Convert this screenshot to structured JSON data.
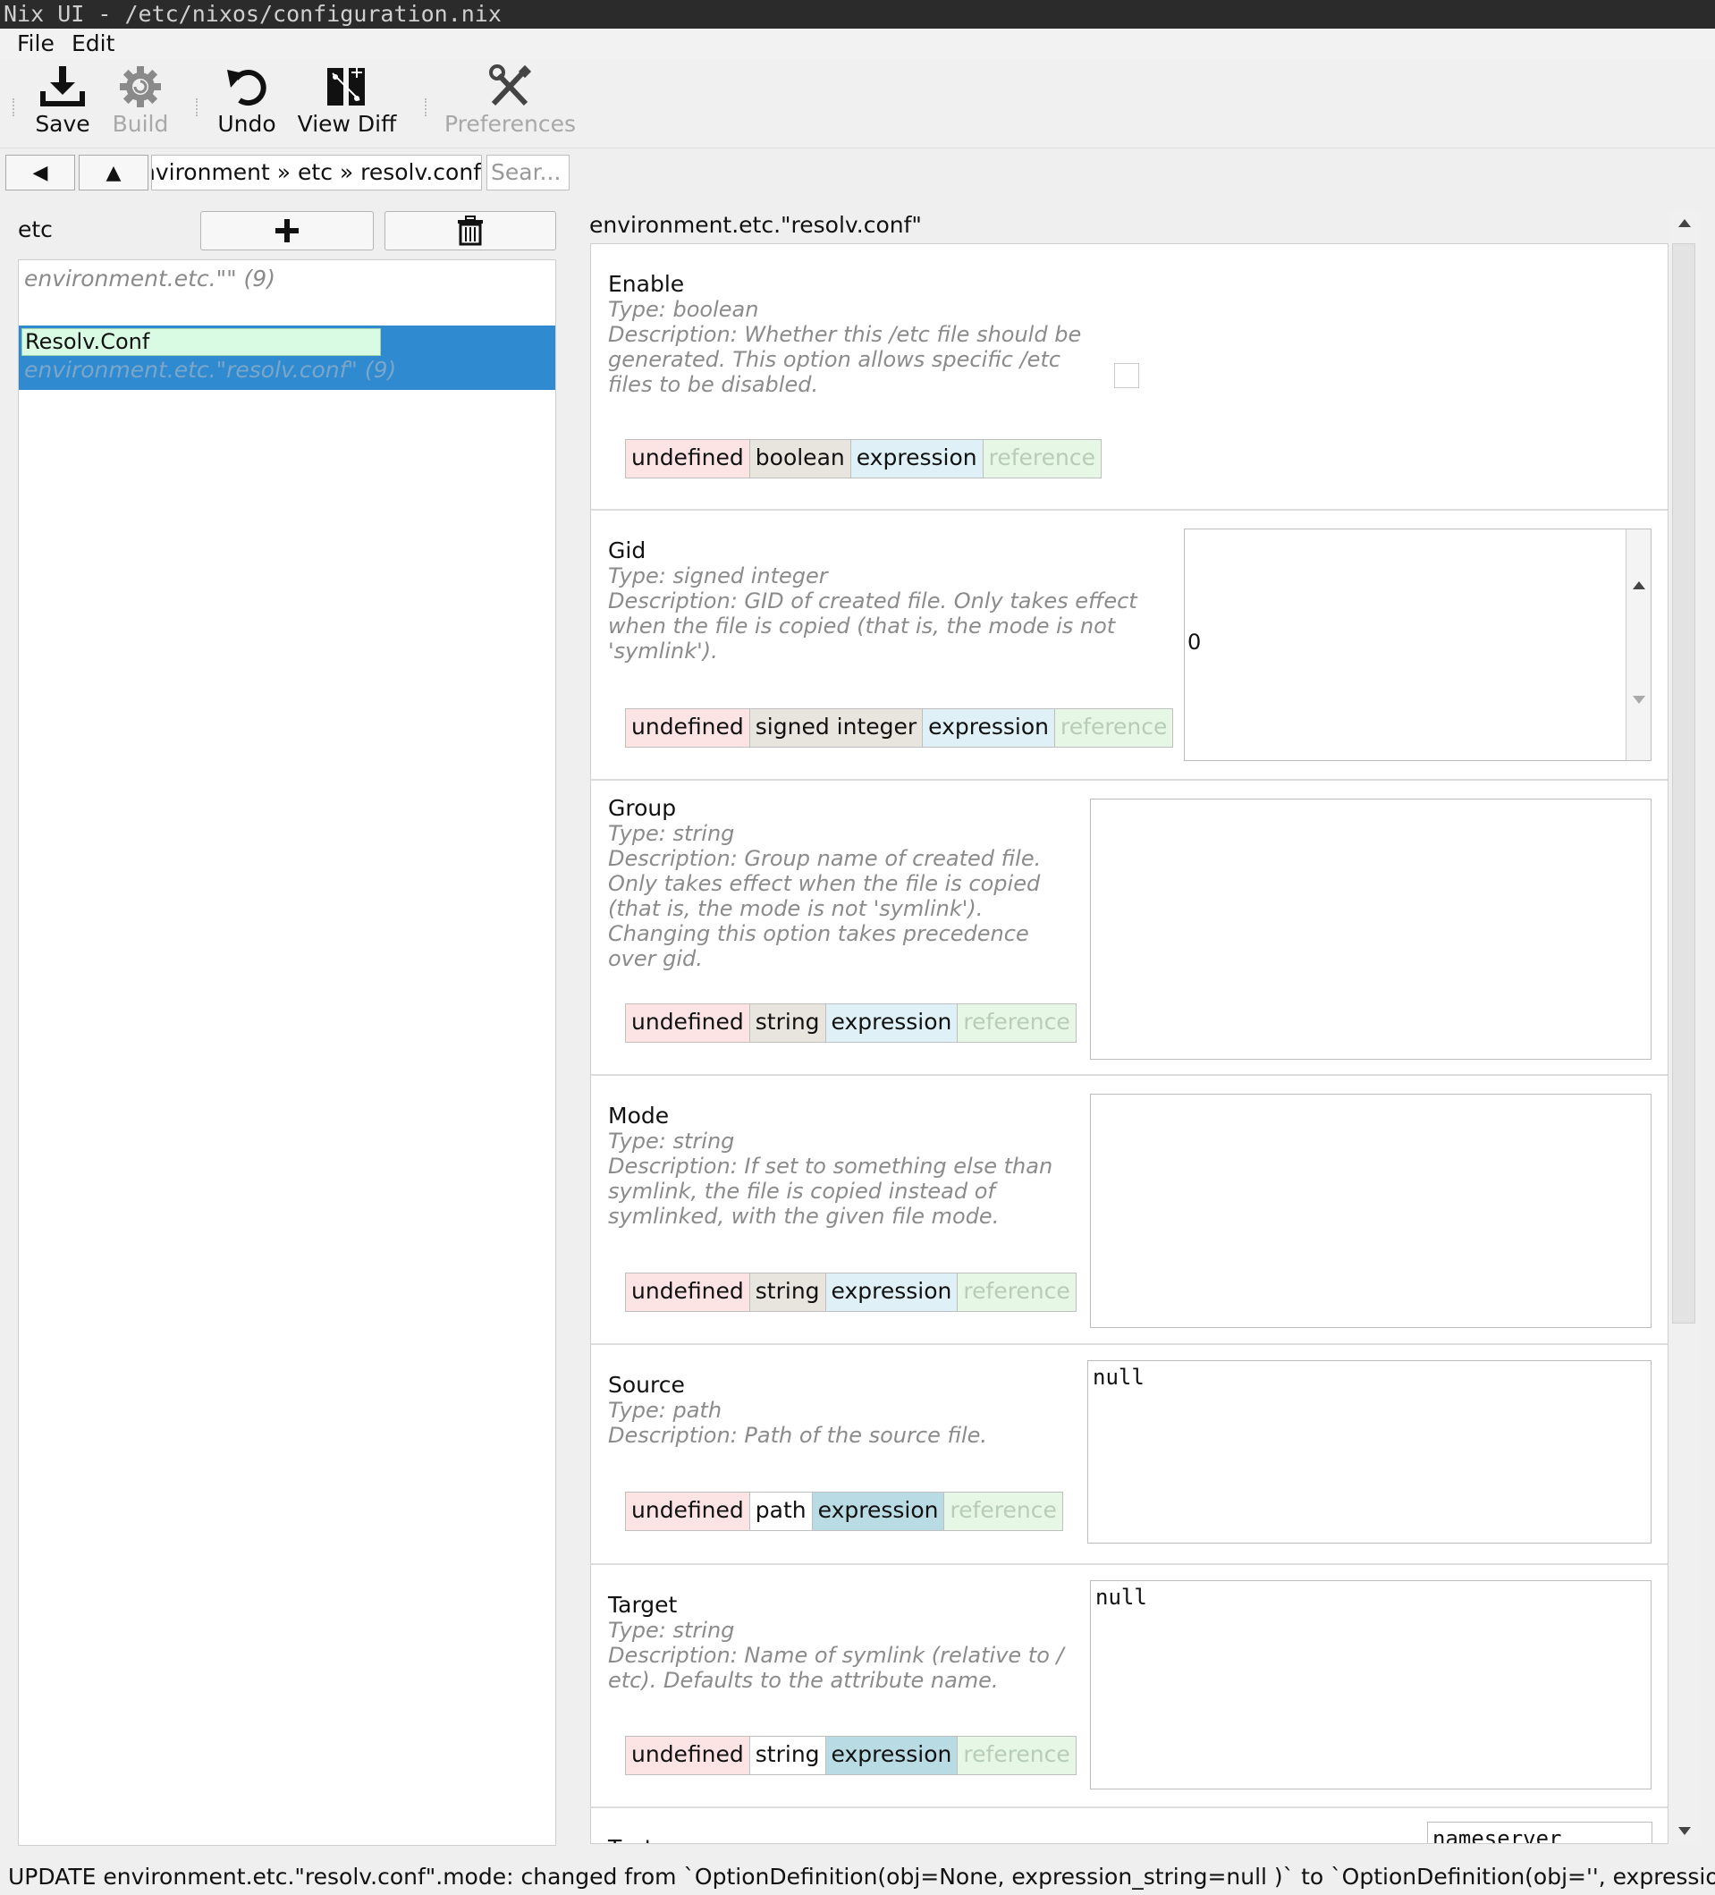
{
  "window": {
    "title": "Nix UI - /etc/nixos/configuration.nix"
  },
  "menu": {
    "file": "File",
    "edit": "Edit"
  },
  "toolbar": {
    "save": "Save",
    "build": "Build",
    "undo": "Undo",
    "view_diff": "View Diff",
    "preferences": "Preferences"
  },
  "nav": {
    "back": "◀",
    "up": "▲",
    "breadcrumb": "environment » etc » resolv.conf",
    "search_placeholder": "Sear..."
  },
  "left": {
    "title": "etc",
    "items": [
      {
        "path": "environment.etc.\"\" (9)"
      },
      {
        "name": "Resolv.Conf",
        "path": "environment.etc.\"resolv.conf\" (9)"
      }
    ]
  },
  "right": {
    "title": "environment.etc.\"resolv.conf\"",
    "options": [
      {
        "name": "Enable",
        "type": "Type: boolean",
        "desc": [
          "Description: Whether this /etc file should be",
          "generated. This option allows specific /etc",
          "files to be disabled."
        ],
        "buttons": [
          "undefined",
          "boolean",
          "expression",
          "reference"
        ],
        "checked": false
      },
      {
        "name": "Gid",
        "type": "Type: signed integer",
        "desc": [
          "Description: GID of created file. Only takes effect",
          "when the file is copied (that is, the mode is not",
          "'symlink')."
        ],
        "buttons": [
          "undefined",
          "signed integer",
          "expression",
          "reference"
        ],
        "value": "0"
      },
      {
        "name": "Group",
        "type": "Type: string",
        "desc": [
          "Description: Group name of created file.",
          "Only takes effect when the file is copied",
          "(that is, the mode is not 'symlink').",
          "Changing this option takes precedence",
          "over gid."
        ],
        "buttons": [
          "undefined",
          "string",
          "expression",
          "reference"
        ],
        "value": ""
      },
      {
        "name": "Mode",
        "type": "Type: string",
        "desc": [
          "Description: If set to something else than",
          "symlink, the file is copied instead of",
          "symlinked, with the given file mode."
        ],
        "buttons": [
          "undefined",
          "string",
          "expression",
          "reference"
        ],
        "value": ""
      },
      {
        "name": "Source",
        "type": "Type: path",
        "desc": [
          "Description: Path of the source file."
        ],
        "buttons": [
          "undefined",
          "path",
          "expression",
          "reference"
        ],
        "value": "null"
      },
      {
        "name": "Target",
        "type": "Type: string",
        "desc": [
          "Description: Name of symlink (relative to /",
          "etc). Defaults to the attribute name."
        ],
        "buttons": [
          "undefined",
          "string",
          "expression",
          "reference"
        ],
        "value": "null"
      },
      {
        "name": "Text",
        "value": "nameserver"
      }
    ]
  },
  "status": "UPDATE environment.etc.\"resolv.conf\".mode: changed from `OptionDefinition(obj=None, expression_string=null )` to `OptionDefinition(obj='', expression_sti"
}
